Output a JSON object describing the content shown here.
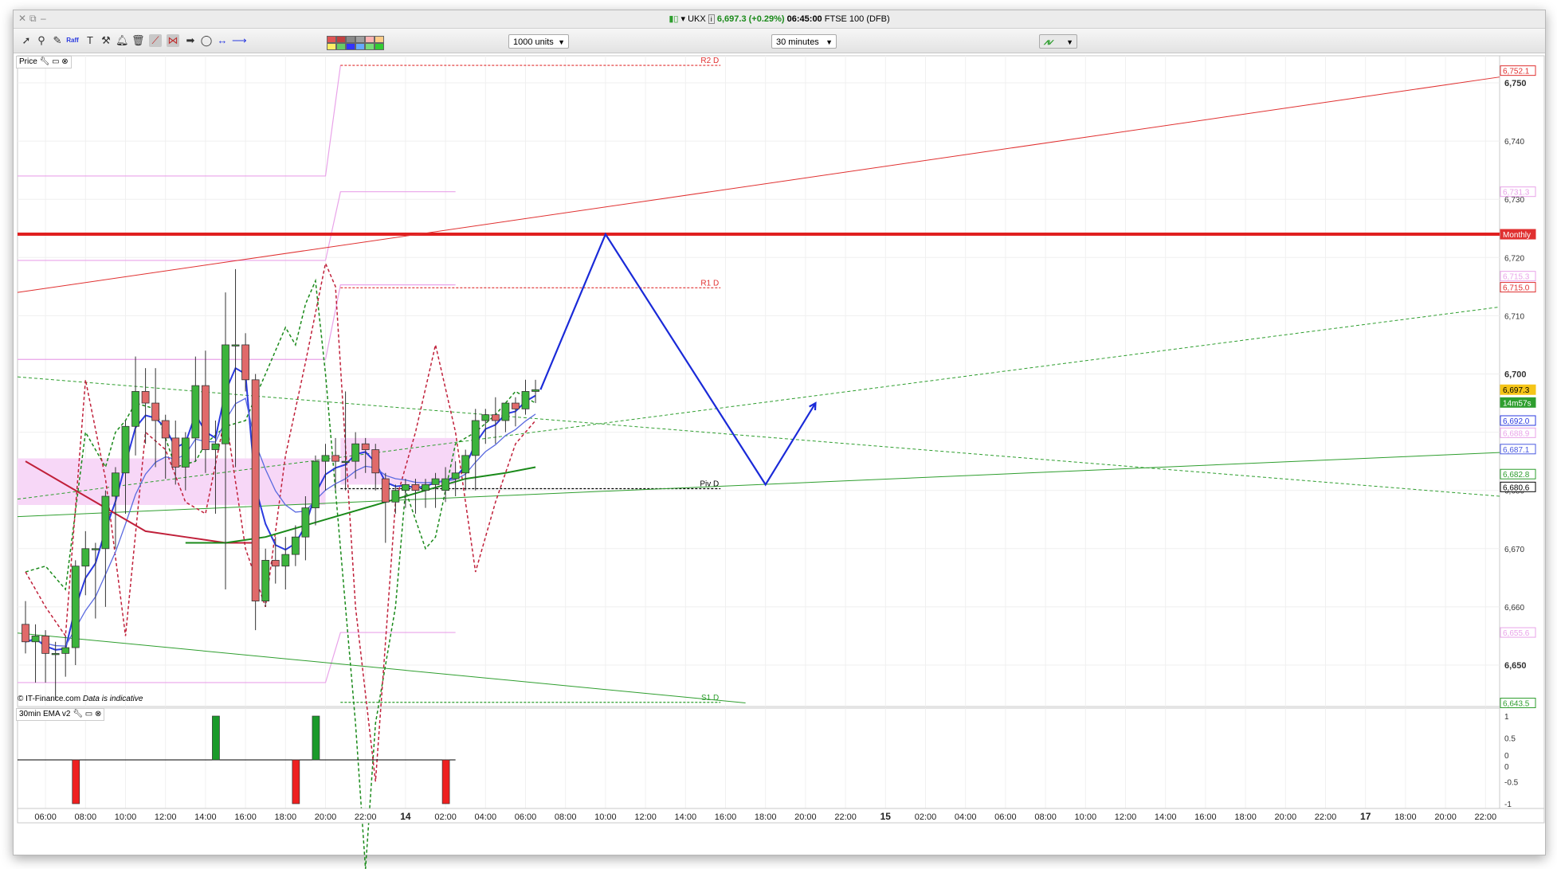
{
  "window": {
    "instrument": "UKX",
    "price": "6,697.3",
    "change": "(+0.29%)",
    "time": "06:45:00",
    "name": "FTSE 100 (DFB)"
  },
  "toolbar": {
    "units": "1000 units",
    "interval": "30 minutes",
    "tool_icons": [
      "pointer-icon",
      "zoom-icon",
      "draw-icon",
      "fib-icon",
      "text-icon",
      "tools-icon",
      "alert-bell-icon",
      "delete-icon",
      "trendline-icon",
      "channel-icon",
      "arrow-icon",
      "ellipse-icon",
      "hline-icon"
    ],
    "swatch_colors": [
      "#e05555",
      "#c04040",
      "#888888",
      "#a0a0a0",
      "#ffb3b3",
      "#ffcc88",
      "#ffee66",
      "#66cc66",
      "#3333ff",
      "#66aaff",
      "#77dd77",
      "#33cc33"
    ]
  },
  "price_panel": {
    "label": "Price",
    "watermark": "© IT-Finance.com",
    "disclaimer": "Data is indicative"
  },
  "indicator_panel": {
    "label": "30min EMA v2",
    "y_ticks": [
      "1",
      "0.5",
      "0",
      "0",
      "-0.5",
      "-1"
    ]
  },
  "axis": {
    "y_ticks": [
      "6,750",
      "6,740",
      "6,730",
      "6,720",
      "6,710",
      "6,700",
      "6,690",
      "6,680",
      "6,670",
      "6,660",
      "6,650"
    ],
    "x_ticks": [
      "06:00",
      "08:00",
      "10:00",
      "12:00",
      "14:00",
      "16:00",
      "18:00",
      "20:00",
      "22:00",
      "14",
      "02:00",
      "04:00",
      "06:00",
      "08:00",
      "10:00",
      "12:00",
      "14:00",
      "16:00",
      "18:00",
      "20:00",
      "22:00",
      "15",
      "02:00",
      "04:00",
      "06:00",
      "08:00",
      "10:00",
      "12:00",
      "14:00",
      "16:00",
      "18:00",
      "20:00",
      "22:00",
      "17",
      "18:00",
      "20:00",
      "22:00"
    ],
    "bold_x_ticks": [
      "14",
      "15",
      "17"
    ]
  },
  "price_tags": [
    {
      "text": "6,752.1",
      "color": "#e03030",
      "style": "outline"
    },
    {
      "text": "6,731.3",
      "color": "#e9a3e9",
      "style": "outline"
    },
    {
      "text": "Monthly",
      "color": "#e03030",
      "style": "fill"
    },
    {
      "text": "6,715.3",
      "color": "#e9a3e9",
      "style": "outline"
    },
    {
      "text": "6,715.0",
      "color": "#e03030",
      "style": "outline"
    },
    {
      "text": "6,697.3",
      "color": "#f5c518",
      "style": "fill"
    },
    {
      "text": "14m57s",
      "color": "#2e9e2e",
      "style": "fill"
    },
    {
      "text": "6,692.0",
      "color": "#2a3ae0",
      "style": "outline"
    },
    {
      "text": "6,688.9",
      "color": "#e9a3e9",
      "style": "outline"
    },
    {
      "text": "6,687.1",
      "color": "#4a5ae0",
      "style": "outline"
    },
    {
      "text": "6,682.8",
      "color": "#2e9e2e",
      "style": "outline"
    },
    {
      "text": "6,680.6",
      "color": "#000000",
      "style": "outline"
    },
    {
      "text": "6,655.6",
      "color": "#e9a3e9",
      "style": "outline"
    },
    {
      "text": "6,643.5",
      "color": "#2e9e2e",
      "style": "outline"
    }
  ],
  "levels": [
    {
      "label": "R2 D",
      "value": 6753.0,
      "color": "#e03030"
    },
    {
      "label": "R1 D",
      "value": 6714.8,
      "color": "#e03030"
    },
    {
      "label": "Piv D",
      "value": 6680.3,
      "color": "#000000"
    },
    {
      "label": "S1 D",
      "value": 6643.6,
      "color": "#2e9e2e"
    }
  ],
  "monthly_level": 6724.0,
  "candles": [
    {
      "t": 0,
      "o": 6657,
      "h": 6661,
      "l": 6652,
      "c": 6654
    },
    {
      "t": 1,
      "o": 6654,
      "h": 6657,
      "l": 6647,
      "c": 6655
    },
    {
      "t": 2,
      "o": 6655,
      "h": 6656,
      "l": 6647,
      "c": 6652
    },
    {
      "t": 3,
      "o": 6652,
      "h": 6654,
      "l": 6644,
      "c": 6652
    },
    {
      "t": 4,
      "o": 6652,
      "h": 6655,
      "l": 6648,
      "c": 6653
    },
    {
      "t": 5,
      "o": 6653,
      "h": 6668,
      "l": 6650,
      "c": 6667
    },
    {
      "t": 6,
      "o": 6667,
      "h": 6673,
      "l": 6662,
      "c": 6670
    },
    {
      "t": 7,
      "o": 6670,
      "h": 6671,
      "l": 6658,
      "c": 6670
    },
    {
      "t": 8,
      "o": 6670,
      "h": 6680,
      "l": 6660,
      "c": 6679
    },
    {
      "t": 9,
      "o": 6679,
      "h": 6684,
      "l": 6670,
      "c": 6683
    },
    {
      "t": 10,
      "o": 6683,
      "h": 6692,
      "l": 6676,
      "c": 6691
    },
    {
      "t": 11,
      "o": 6691,
      "h": 6703,
      "l": 6686,
      "c": 6697
    },
    {
      "t": 12,
      "o": 6697,
      "h": 6701,
      "l": 6688,
      "c": 6695
    },
    {
      "t": 13,
      "o": 6695,
      "h": 6701,
      "l": 6684,
      "c": 6692
    },
    {
      "t": 14,
      "o": 6692,
      "h": 6693,
      "l": 6682,
      "c": 6689
    },
    {
      "t": 15,
      "o": 6689,
      "h": 6692,
      "l": 6681,
      "c": 6684
    },
    {
      "t": 16,
      "o": 6684,
      "h": 6690,
      "l": 6680,
      "c": 6689
    },
    {
      "t": 17,
      "o": 6689,
      "h": 6703,
      "l": 6685,
      "c": 6698
    },
    {
      "t": 18,
      "o": 6698,
      "h": 6704,
      "l": 6683,
      "c": 6687
    },
    {
      "t": 19,
      "o": 6687,
      "h": 6692,
      "l": 6676,
      "c": 6688
    },
    {
      "t": 20,
      "o": 6688,
      "h": 6714,
      "l": 6663,
      "c": 6705
    },
    {
      "t": 21,
      "o": 6705,
      "h": 6718,
      "l": 6684,
      "c": 6705
    },
    {
      "t": 22,
      "o": 6705,
      "h": 6707,
      "l": 6697,
      "c": 6699
    },
    {
      "t": 23,
      "o": 6699,
      "h": 6700,
      "l": 6656,
      "c": 6661
    },
    {
      "t": 24,
      "o": 6661,
      "h": 6670,
      "l": 6660,
      "c": 6668
    },
    {
      "t": 25,
      "o": 6668,
      "h": 6672,
      "l": 6664,
      "c": 6667
    },
    {
      "t": 26,
      "o": 6667,
      "h": 6672,
      "l": 6663,
      "c": 6669
    },
    {
      "t": 27,
      "o": 6669,
      "h": 6674,
      "l": 6667,
      "c": 6672
    },
    {
      "t": 28,
      "o": 6672,
      "h": 6679,
      "l": 6668,
      "c": 6677
    },
    {
      "t": 29,
      "o": 6677,
      "h": 6686,
      "l": 6674,
      "c": 6685
    },
    {
      "t": 30,
      "o": 6685,
      "h": 6688,
      "l": 6680,
      "c": 6686
    },
    {
      "t": 31,
      "o": 6686,
      "h": 6689,
      "l": 6680,
      "c": 6685
    },
    {
      "t": 32,
      "o": 6685,
      "h": 6697,
      "l": 6680,
      "c": 6685
    },
    {
      "t": 33,
      "o": 6685,
      "h": 6690,
      "l": 6682,
      "c": 6688
    },
    {
      "t": 34,
      "o": 6688,
      "h": 6689,
      "l": 6683,
      "c": 6687
    },
    {
      "t": 35,
      "o": 6687,
      "h": 6688,
      "l": 6680,
      "c": 6683
    },
    {
      "t": 36,
      "o": 6682,
      "h": 6683,
      "l": 6671,
      "c": 6678
    },
    {
      "t": 37,
      "o": 6678,
      "h": 6681,
      "l": 6676,
      "c": 6680
    },
    {
      "t": 38,
      "o": 6680,
      "h": 6682,
      "l": 6677,
      "c": 6681
    },
    {
      "t": 39,
      "o": 6681,
      "h": 6682,
      "l": 6676,
      "c": 6680
    },
    {
      "t": 40,
      "o": 6680,
      "h": 6682,
      "l": 6677,
      "c": 6681
    },
    {
      "t": 41,
      "o": 6681,
      "h": 6683,
      "l": 6677,
      "c": 6682
    },
    {
      "t": 42,
      "o": 6680,
      "h": 6684,
      "l": 6678,
      "c": 6682
    },
    {
      "t": 43,
      "o": 6682,
      "h": 6685,
      "l": 6679,
      "c": 6683
    },
    {
      "t": 44,
      "o": 6683,
      "h": 6687,
      "l": 6680,
      "c": 6686
    },
    {
      "t": 45,
      "o": 6686,
      "h": 6694,
      "l": 6680,
      "c": 6692
    },
    {
      "t": 46,
      "o": 6692,
      "h": 6694,
      "l": 6688,
      "c": 6693
    },
    {
      "t": 47,
      "o": 6693,
      "h": 6696,
      "l": 6688,
      "c": 6692
    },
    {
      "t": 48,
      "o": 6692,
      "h": 6695,
      "l": 6690,
      "c": 6695
    },
    {
      "t": 49,
      "o": 6695,
      "h": 6696,
      "l": 6691,
      "c": 6694
    },
    {
      "t": 50,
      "o": 6694,
      "h": 6699,
      "l": 6693,
      "c": 6697
    },
    {
      "t": 51,
      "o": 6697,
      "h": 6699,
      "l": 6695,
      "c": 6697.3
    }
  ],
  "projection": [
    {
      "t": 51.5,
      "v": 6697.3
    },
    {
      "t": 58,
      "v": 6724.0
    },
    {
      "t": 74,
      "v": 6681.0
    },
    {
      "t": 79,
      "v": 6695.0
    }
  ],
  "indicator_bars": [
    {
      "t": 5,
      "v": -1
    },
    {
      "t": 19,
      "v": 1
    },
    {
      "t": 27,
      "v": -1
    },
    {
      "t": 29,
      "v": 1
    },
    {
      "t": 42,
      "v": -1
    }
  ]
}
